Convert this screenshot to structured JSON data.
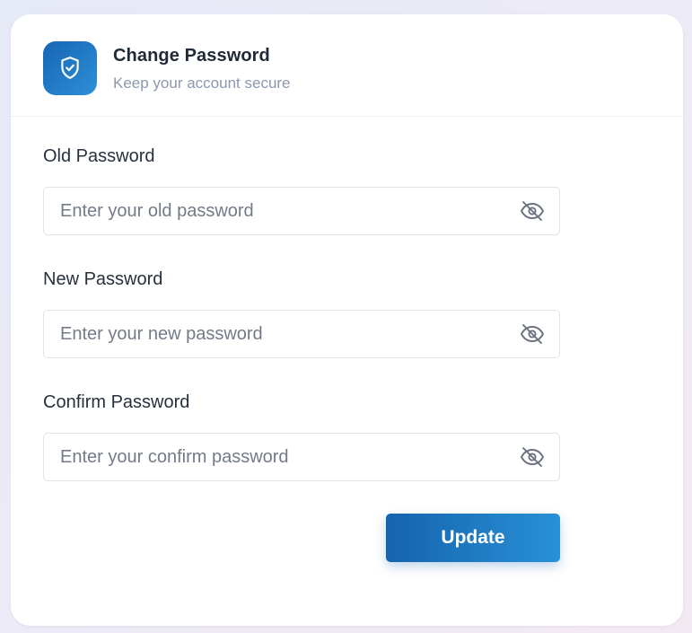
{
  "header": {
    "title": "Change Password",
    "subtitle": "Keep your account secure",
    "icon": "shield-check-icon",
    "accent_gradient": [
      "#1766b3",
      "#2e8fd6"
    ]
  },
  "form": {
    "fields": [
      {
        "label": "Old Password",
        "placeholder": "Enter your old password",
        "value": "",
        "toggle_icon": "eye-off-icon"
      },
      {
        "label": "New Password",
        "placeholder": "Enter your new password",
        "value": "",
        "toggle_icon": "eye-off-icon"
      },
      {
        "label": "Confirm Password",
        "placeholder": "Enter your confirm password",
        "value": "",
        "toggle_icon": "eye-off-icon"
      }
    ],
    "submit_label": "Update",
    "submit_gradient": [
      "#1563ad",
      "#2891d6"
    ]
  }
}
